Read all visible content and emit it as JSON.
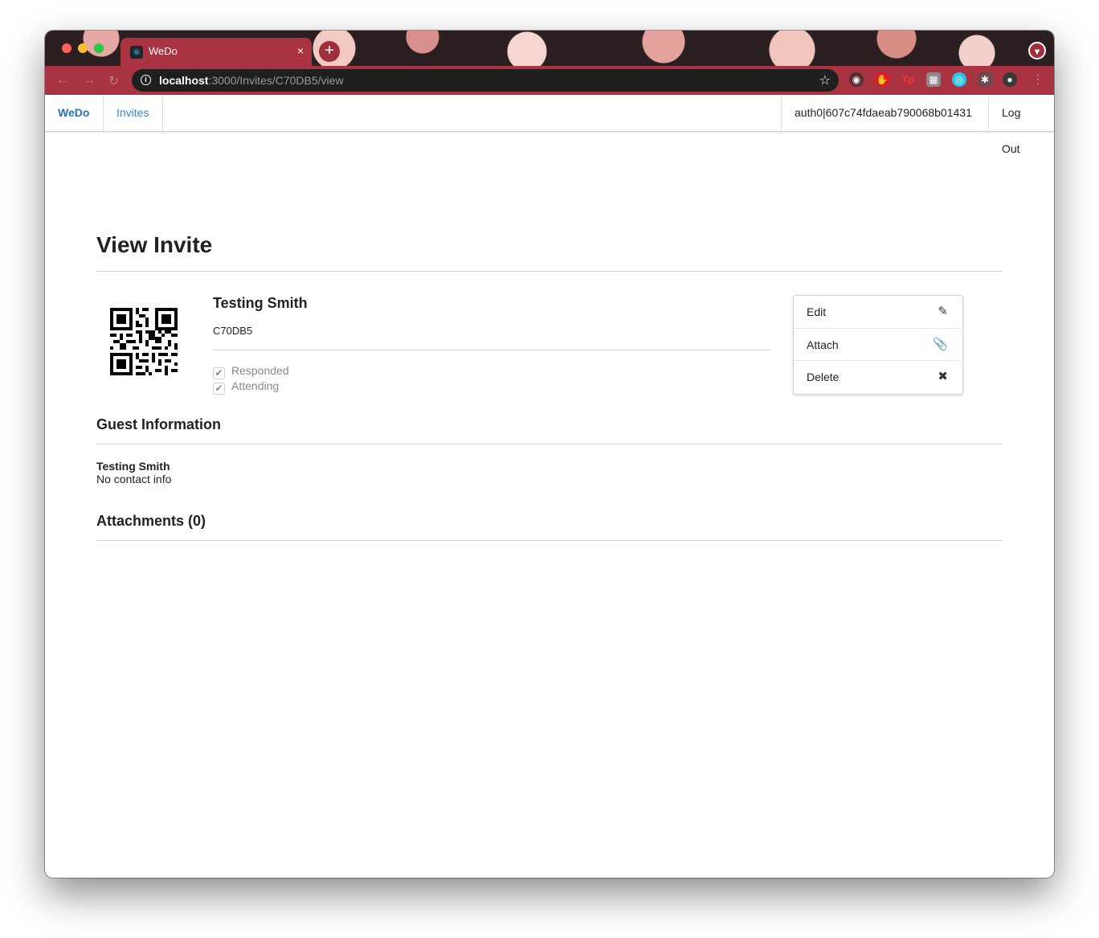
{
  "browser": {
    "tab_title": "WeDo",
    "tab_close": "×",
    "new_tab": "+",
    "url_host": "localhost",
    "url_path": ":3000/Invites/C70DB5/view"
  },
  "nav": {
    "brand": "WeDo",
    "invites": "Invites",
    "user": "auth0|607c74fdaeab790068b01431",
    "logout": "Log Out"
  },
  "page": {
    "title": "View Invite"
  },
  "invite": {
    "name": "Testing Smith",
    "code": "C70DB5",
    "responded_label": "Responded",
    "attending_label": "Attending",
    "responded": true,
    "attending": true
  },
  "actions": {
    "edit": "Edit",
    "attach": "Attach",
    "delete": "Delete"
  },
  "guest_section": {
    "title": "Guest Information",
    "guest_name": "Testing Smith",
    "contact": "No contact info"
  },
  "attachments": {
    "title": "Attachments (0)"
  },
  "icons": {
    "edit": "pencil-icon",
    "attach": "paperclip-icon",
    "delete": "x-icon"
  },
  "colors": {
    "chrome_tab": "#a93340",
    "link": "#4183c4",
    "brand": "#2a71b4"
  }
}
